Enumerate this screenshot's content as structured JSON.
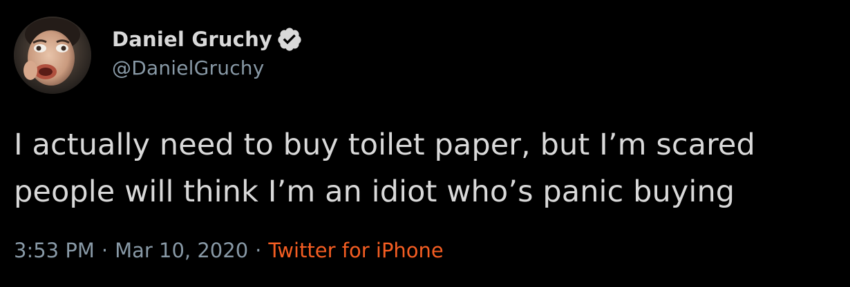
{
  "author": {
    "display_name": "Daniel Gruchy",
    "handle": "@DanielGruchy",
    "verified": true,
    "verified_icon": "verified-badge-icon"
  },
  "tweet": {
    "lines": [
      "I actually need to buy toilet paper, but I’m scared",
      "people will think I’m an idiot who’s panic buying"
    ],
    "time": "3:53 PM",
    "separator": "·",
    "date": "Mar 10, 2020",
    "source": "Twitter for iPhone"
  },
  "colors": {
    "background": "#000000",
    "text": "#d9d9d9",
    "muted": "#8899a6",
    "source_link": "#f45d22"
  }
}
